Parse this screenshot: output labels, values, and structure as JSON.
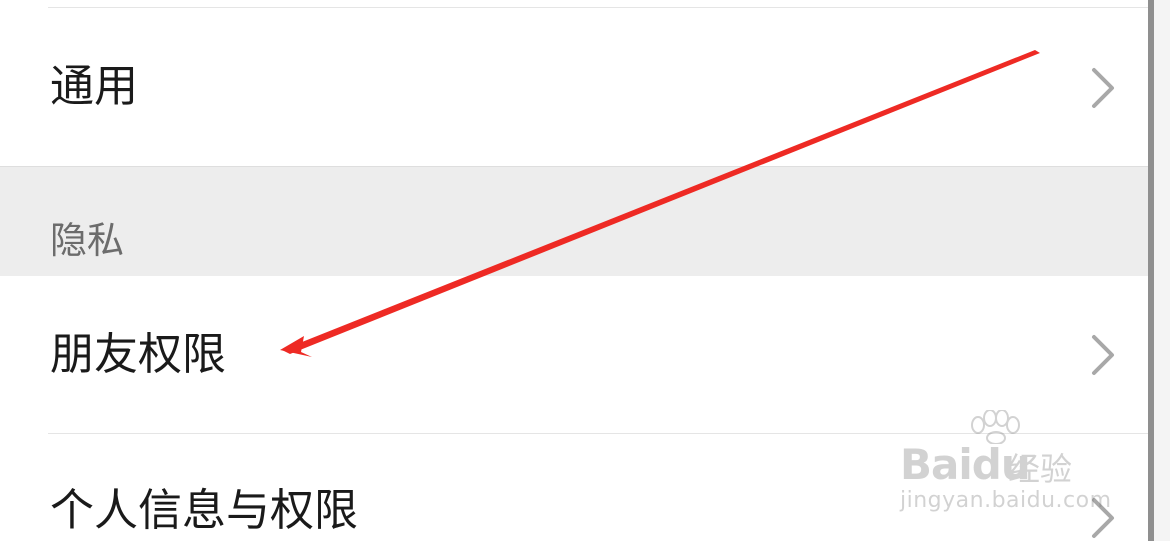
{
  "settings": {
    "general": {
      "label": "通用",
      "icon": "chevron-right-icon"
    },
    "privacy_section": {
      "title": "隐私"
    },
    "friend_permissions": {
      "label": "朋友权限",
      "icon": "chevron-right-icon"
    },
    "personal_info_permissions": {
      "label": "个人信息与权限",
      "icon": "chevron-right-icon"
    }
  },
  "annotation": {
    "type": "arrow",
    "color": "#ee2a24",
    "target": "friend_permissions"
  },
  "watermark": {
    "brand": "Baidu",
    "suffix": "经验",
    "url": "jingyan.baidu.com"
  }
}
